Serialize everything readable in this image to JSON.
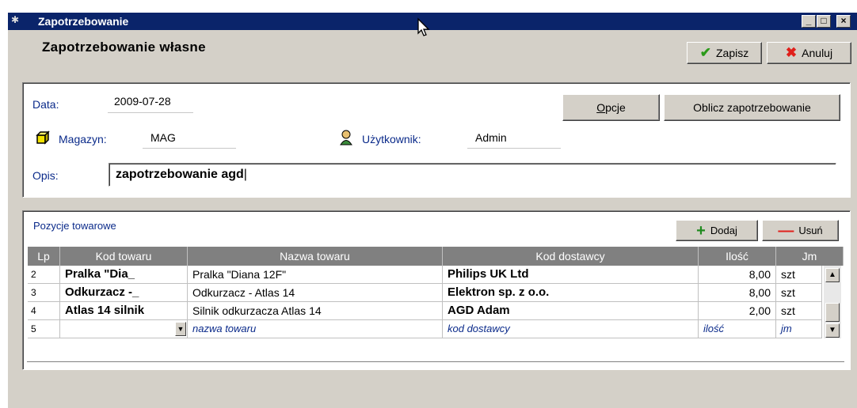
{
  "window": {
    "title": "Zapotrzebowanie",
    "min_btn": "_",
    "max_btn": "□",
    "close_btn": "×"
  },
  "header": {
    "title": "Zapotrzebowanie własne",
    "save_label": "Zapisz",
    "cancel_label": "Anuluj"
  },
  "form": {
    "date_label": "Data:",
    "date_value": "2009-07-28",
    "warehouse_label": "Magazyn:",
    "warehouse_value": "MAG",
    "user_label": "Użytkownik:",
    "user_value": "Admin",
    "desc_label": "Opis:",
    "desc_value": "zapotrzebowanie agd",
    "options_label": "Opcje",
    "options_label_rest": "pcje",
    "options_label_mnemonic": "O",
    "calc_label": "Oblicz zapotrzebowanie"
  },
  "items": {
    "section_title": "Pozycje towarowe",
    "add_label": "Dodaj",
    "remove_label": "Usuń",
    "columns": [
      "Lp",
      "Kod towaru",
      "Nazwa towaru",
      "Kod dostawcy",
      "Ilość",
      "Jm"
    ],
    "rows": [
      {
        "lp": "2",
        "code": "Pralka \"Dia_",
        "name": "Pralka \"Diana 12F\"",
        "supplier": "Philips UK Ltd",
        "qty": "8,00",
        "unit": "szt"
      },
      {
        "lp": "3",
        "code": "Odkurzacz -_",
        "name": "Odkurzacz - Atlas 14",
        "supplier": "Elektron sp. z o.o.",
        "qty": "8,00",
        "unit": "szt"
      },
      {
        "lp": "4",
        "code": "Atlas 14 silnik",
        "name": "Silnik odkurzacza Atlas 14",
        "supplier": "AGD Adam",
        "qty": "2,00",
        "unit": "szt"
      }
    ],
    "new_row": {
      "lp": "5",
      "name": "nazwa towaru",
      "supplier": "kod dostawcy",
      "qty": "ilość",
      "unit": "jm"
    }
  },
  "colors": {
    "titlebar": "#0a246a",
    "face": "#d4d0c8",
    "label_blue": "#0a2a8a",
    "grid_header": "#808080"
  },
  "icons": [
    "window-icon",
    "check-icon",
    "cross-icon",
    "box-icon",
    "user-icon",
    "plus-icon",
    "minus-icon",
    "dropdown-icon",
    "scroll-up-icon",
    "scroll-down-icon",
    "mouse-cursor-icon"
  ]
}
